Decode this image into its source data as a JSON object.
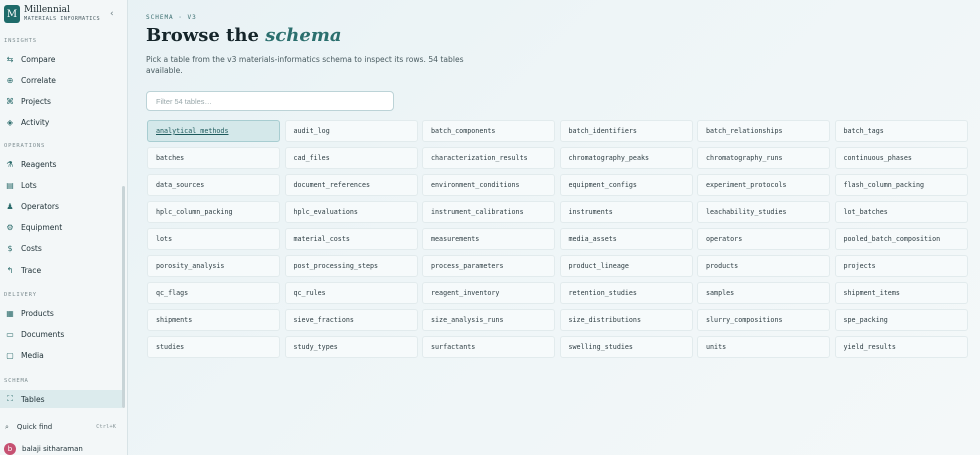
{
  "brand": {
    "logo": "M",
    "name": "Millennial",
    "subtitle": "MATERIALS INFORMATICS",
    "collapse_icon": "chevron-left-icon"
  },
  "sidebar": {
    "sections": [
      {
        "label": "INSIGHTS",
        "items": [
          {
            "label": "Compare",
            "icon": "compare-icon",
            "glyph": "⇆"
          },
          {
            "label": "Correlate",
            "icon": "correlate-icon",
            "glyph": "⊕"
          },
          {
            "label": "Projects",
            "icon": "projects-icon",
            "glyph": "⌘"
          },
          {
            "label": "Activity",
            "icon": "activity-icon",
            "glyph": "◈"
          }
        ]
      },
      {
        "label": "OPERATIONS",
        "items": [
          {
            "label": "Reagents",
            "icon": "reagents-icon",
            "glyph": "⚗"
          },
          {
            "label": "Lots",
            "icon": "lots-icon",
            "glyph": "▤"
          },
          {
            "label": "Operators",
            "icon": "operators-icon",
            "glyph": "♟"
          },
          {
            "label": "Equipment",
            "icon": "equipment-icon",
            "glyph": "⚙"
          },
          {
            "label": "Costs",
            "icon": "costs-icon",
            "glyph": "$"
          },
          {
            "label": "Trace",
            "icon": "trace-icon",
            "glyph": "↰"
          }
        ]
      },
      {
        "label": "DELIVERY",
        "items": [
          {
            "label": "Products",
            "icon": "products-icon",
            "glyph": "▦"
          },
          {
            "label": "Documents",
            "icon": "documents-icon",
            "glyph": "▭"
          },
          {
            "label": "Media",
            "icon": "media-icon",
            "glyph": "▢"
          }
        ]
      },
      {
        "label": "SCHEMA",
        "items": [
          {
            "label": "Tables",
            "icon": "tables-icon",
            "glyph": "⛶",
            "active": true
          }
        ]
      }
    ],
    "quick_find": {
      "label": "Quick find",
      "shortcut": "Ctrl+K",
      "icon": "search-icon"
    },
    "user": {
      "initial": "b",
      "name": "balaji sitharaman"
    }
  },
  "main": {
    "eyebrow": "SCHEMA · V3",
    "title_plain": "Browse the",
    "title_emphasis": "schema",
    "subtitle": "Pick a table from the v3 materials-informatics schema to inspect its rows. 54 tables available.",
    "filter": {
      "placeholder": "Filter 54 tables…",
      "value": ""
    },
    "selected_table": "analytical_methods",
    "tables": [
      "analytical_methods",
      "audit_log",
      "batch_components",
      "batch_identifiers",
      "batch_relationships",
      "batch_tags",
      "batches",
      "cad_files",
      "characterization_results",
      "chromatography_peaks",
      "chromatography_runs",
      "continuous_phases",
      "data_sources",
      "document_references",
      "environment_conditions",
      "equipment_configs",
      "experiment_protocols",
      "flash_column_packing",
      "hplc_column_packing",
      "hplc_evaluations",
      "instrument_calibrations",
      "instruments",
      "leachability_studies",
      "lot_batches",
      "lots",
      "material_costs",
      "measurements",
      "media_assets",
      "operators",
      "pooled_batch_composition",
      "porosity_analysis",
      "post_processing_steps",
      "process_parameters",
      "product_lineage",
      "products",
      "projects",
      "qc_flags",
      "qc_rules",
      "reagent_inventory",
      "retention_studies",
      "samples",
      "shipment_items",
      "shipments",
      "sieve_fractions",
      "size_analysis_runs",
      "size_distributions",
      "slurry_compositions",
      "spe_packing",
      "studies",
      "study_types",
      "surfactants",
      "swelling_studies",
      "units",
      "yield_results"
    ]
  }
}
